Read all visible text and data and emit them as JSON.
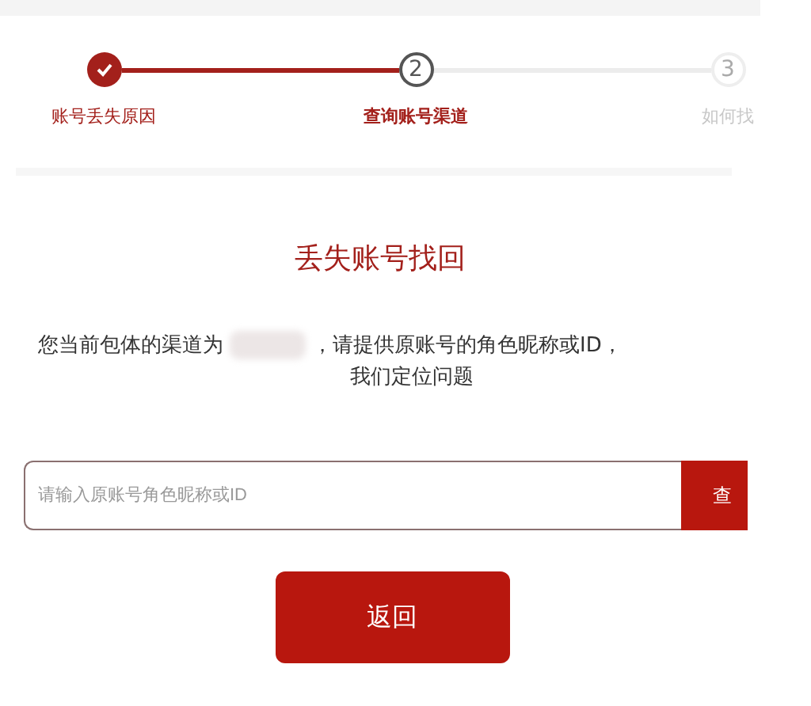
{
  "steps": [
    {
      "done": true,
      "selected": false,
      "label": "账号丢失原因"
    },
    {
      "done": false,
      "selected": true,
      "number": "2",
      "label": "查询账号渠道"
    },
    {
      "done": false,
      "selected": false,
      "number": "3",
      "label": "如何找"
    }
  ],
  "title": "丢失账号找回",
  "notice": {
    "before": "您当前包体的渠道为",
    "after": "，请提供原账号的角色昵称或ID，",
    "line2": "我们定位问题"
  },
  "search": {
    "placeholder": "请输入原账号角色昵称或ID",
    "button": "查"
  },
  "back_button": "返回"
}
